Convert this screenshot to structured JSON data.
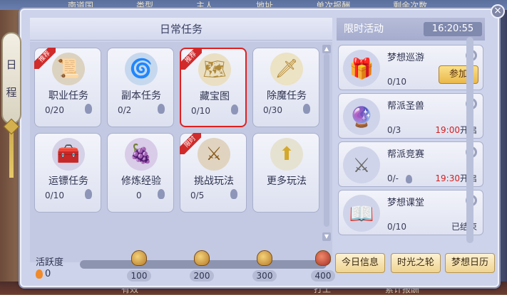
{
  "background": {
    "tabs": [
      "南道国",
      "类型",
      "主人",
      "地址",
      "单次报酬",
      "剩余次数"
    ],
    "bottom_text": [
      "有效",
      "打工",
      "累计报酬"
    ]
  },
  "side_tab": {
    "label_1": "日",
    "label_2": "程"
  },
  "daily": {
    "title": "日常任务",
    "tasks": [
      {
        "name": "职业任务",
        "progress": "0/20",
        "icon": "scroll-icon",
        "badge": "推荐"
      },
      {
        "name": "副本任务",
        "progress": "0/2",
        "icon": "portal-icon",
        "badge": ""
      },
      {
        "name": "藏宝图",
        "progress": "0/10",
        "icon": "treasure-map-icon",
        "badge": "推荐"
      },
      {
        "name": "除魔任务",
        "progress": "0/30",
        "icon": "demon-sword-icon",
        "badge": ""
      },
      {
        "name": "运镖任务",
        "progress": "0/10",
        "icon": "chest-icon",
        "badge": ""
      },
      {
        "name": "修炼经验",
        "progress": "0",
        "icon": "fruit-icon",
        "badge": ""
      },
      {
        "name": "挑战玩法",
        "progress": "0/5",
        "icon": "mask-icon",
        "badge": "限时"
      },
      {
        "name": "更多玩法",
        "progress": "",
        "icon": "arrow-up-icon",
        "badge": ""
      }
    ]
  },
  "limited": {
    "title": "限时活动",
    "clock": "16:20:55",
    "activities": [
      {
        "name": "梦想巡游",
        "progress": "0/10",
        "icon": "parade-chest-icon",
        "button": "参加",
        "time": "",
        "status": ""
      },
      {
        "name": "帮派圣兽",
        "progress": "0/3",
        "icon": "beast-orb-icon",
        "button": "",
        "time": "19:00",
        "status": "开启"
      },
      {
        "name": "帮派竞赛",
        "progress": "0/-",
        "icon": "crossed-swords-icon",
        "button": "",
        "time": "19:30",
        "status": "开启"
      },
      {
        "name": "梦想课堂",
        "progress": "0/10",
        "icon": "book-icon",
        "button": "",
        "time": "",
        "status": "已结束"
      }
    ]
  },
  "activity_bar": {
    "label": "活跃度",
    "value": "0",
    "progress_fraction": 0,
    "milestones": [
      "100",
      "200",
      "300",
      "400"
    ]
  },
  "buttons": {
    "today_info": "今日信息",
    "time_wheel": "时光之轮",
    "dream_calendar": "梦想日历"
  },
  "colors": {
    "accent_red": "#d42020",
    "highlight_border": "#e02020",
    "gold": "#f0a840"
  }
}
